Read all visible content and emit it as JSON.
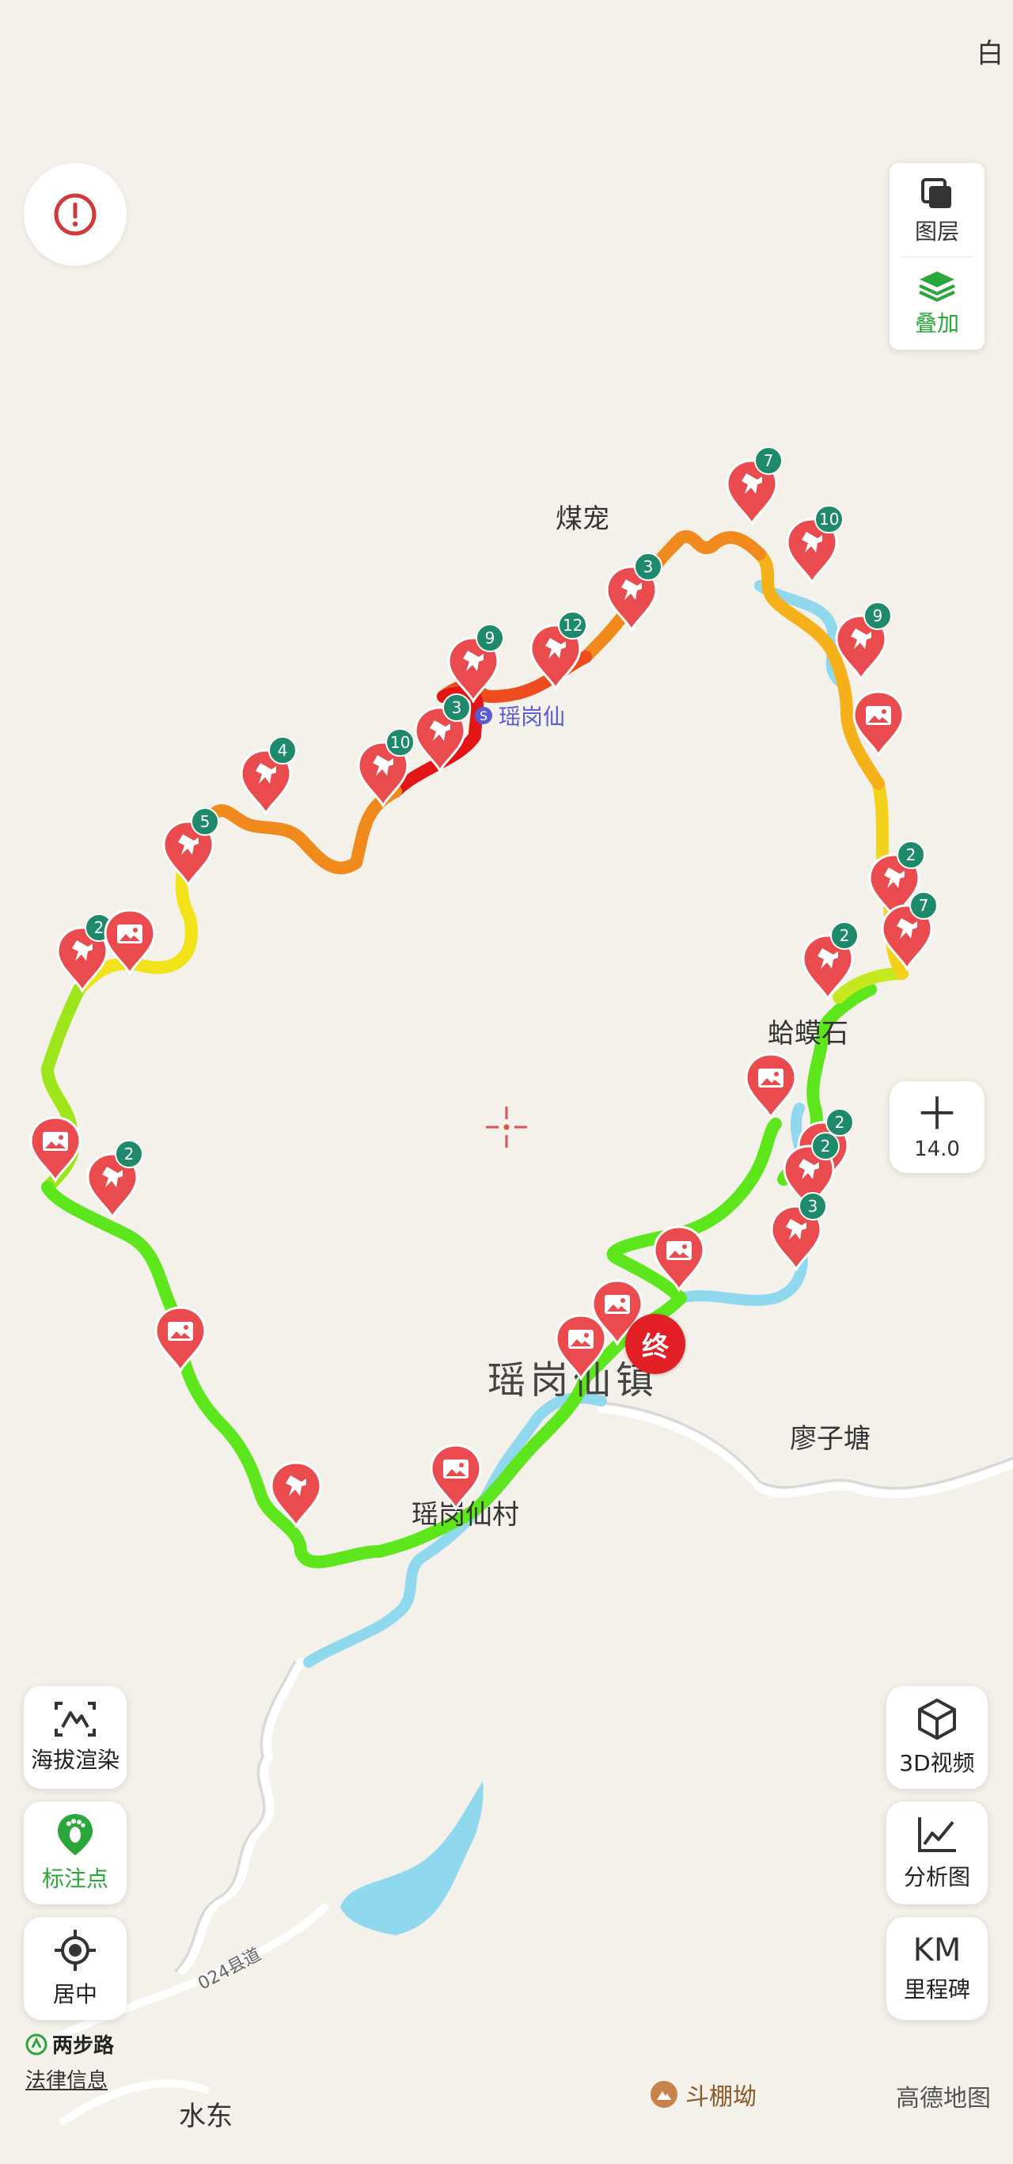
{
  "map": {
    "labels": {
      "top_right_partial": "白",
      "meichong": "煤宠",
      "yaogangxian": "瑶岗仙",
      "hamashi": "蛤蟆石",
      "town": "瑶岗仙镇",
      "liaozitang": "廖子塘",
      "village": "瑶岗仙村",
      "shuidong": "水东",
      "road": "024县道"
    },
    "poi_label": "斗棚坳",
    "end_marker": "终",
    "pin_counts": [
      "7",
      "10",
      "3",
      "12",
      "9",
      "3",
      "10",
      "4",
      "5",
      "2",
      "9",
      "2",
      "7",
      "2",
      "2",
      "2",
      "3",
      "2"
    ]
  },
  "controls": {
    "layers_label": "图层",
    "overlay_label": "叠加",
    "zoom_level": "14.0",
    "elevation_label": "海拔渲染",
    "markers_label": "标注点",
    "center_label": "居中",
    "video3d_label": "3D视频",
    "analysis_label": "分析图",
    "milestone_icon_text": "KM",
    "milestone_label": "里程碑"
  },
  "footer": {
    "brand": "两步路",
    "legal": "法律信息",
    "attribution": "高德地图"
  },
  "colors": {
    "pin": "#e94b4f",
    "badge": "#1f8a6b",
    "water": "#8fd8ee",
    "accent_green": "#2aa63a",
    "end": "#e21f25"
  }
}
